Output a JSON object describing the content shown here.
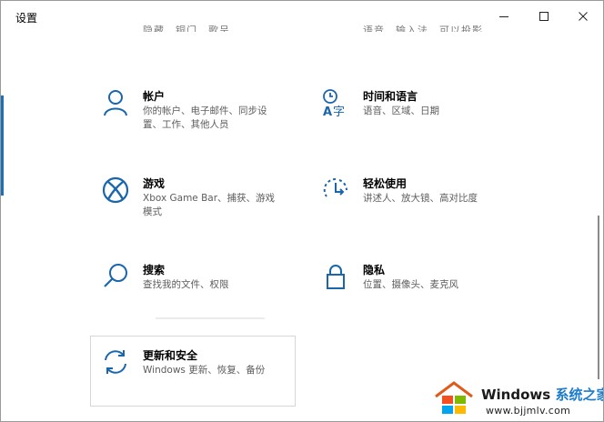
{
  "window": {
    "title": "设置"
  },
  "top_partial": {
    "left": "隐藏、铜门、歌呈",
    "right": "语音、输入法、可以投影"
  },
  "tiles": [
    {
      "name": "帐户",
      "desc": "你的帐户、电子邮件、同步设置、工作、其他人员",
      "icon": "person-icon"
    },
    {
      "name": "时间和语言",
      "desc": "语音、区域、日期",
      "icon": "time-language-icon"
    },
    {
      "name": "游戏",
      "desc": "Xbox Game Bar、捕获、游戏模式",
      "icon": "xbox-icon"
    },
    {
      "name": "轻松使用",
      "desc": "讲述人、放大镜、高对比度",
      "icon": "ease-of-access-icon"
    },
    {
      "name": "搜索",
      "desc": "查找我的文件、权限",
      "icon": "search-icon"
    },
    {
      "name": "隐私",
      "desc": "位置、摄像头、麦克风",
      "icon": "lock-icon"
    },
    {
      "name": "更新和安全",
      "desc": "Windows 更新、恢复、备份",
      "icon": "sync-icon"
    }
  ],
  "watermark": {
    "brand": "Windows",
    "brand_cn": "系统之家",
    "url": "www.bjjmlv.com"
  },
  "colors": {
    "accent": "#0067c0",
    "icon": "#1a66ad"
  }
}
